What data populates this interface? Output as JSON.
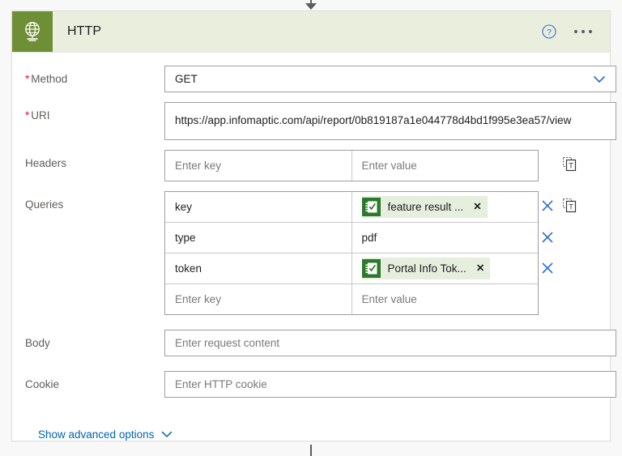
{
  "header": {
    "title": "HTTP",
    "icon": "globe-icon",
    "help_icon": "help-circle-icon",
    "more_icon": "ellipsis-icon",
    "bg_color": "#e9eedd",
    "icon_bg_color": "#6f8f37"
  },
  "colors": {
    "accent_link": "#0063b1",
    "required_asterisk": "#e81123",
    "token_chip_bg": "#e6eede",
    "token_icon_bg": "#2b7a2b"
  },
  "fields": {
    "method": {
      "label": "Method",
      "required": true,
      "value": "GET",
      "chevron_icon": "chevron-down-icon"
    },
    "uri": {
      "label": "URI",
      "required": true,
      "value": "https://app.infomaptic.com/api/report/0b819187a1e044778d4bd1f995e3ea57/view"
    },
    "headers": {
      "label": "Headers",
      "required": false,
      "key_placeholder": "Enter key",
      "value_placeholder": "Enter value",
      "text_mode_icon": "switch-to-text-mode-icon"
    },
    "queries": {
      "label": "Queries",
      "required": false,
      "key_placeholder": "Enter key",
      "value_placeholder": "Enter value",
      "text_mode_icon": "switch-to-text-mode-icon",
      "rows": [
        {
          "key": "key",
          "value_type": "token",
          "value": "feature result ...",
          "token_icon": "dynamic-content-checklist-icon",
          "remove_token_icon": "x-icon",
          "delete_icon": "x-icon"
        },
        {
          "key": "type",
          "value_type": "text",
          "value": "pdf",
          "delete_icon": "x-icon"
        },
        {
          "key": "token",
          "value_type": "token",
          "value": "Portal Info Tok...",
          "token_icon": "dynamic-content-checklist-icon",
          "remove_token_icon": "x-icon",
          "delete_icon": "x-icon"
        },
        {
          "key": "",
          "value_type": "empty",
          "value": ""
        }
      ]
    },
    "body": {
      "label": "Body",
      "required": false,
      "placeholder": "Enter request content",
      "value": ""
    },
    "cookie": {
      "label": "Cookie",
      "required": false,
      "placeholder": "Enter HTTP cookie",
      "value": ""
    }
  },
  "advanced": {
    "label": "Show advanced options",
    "chevron_icon": "chevron-down-icon"
  }
}
